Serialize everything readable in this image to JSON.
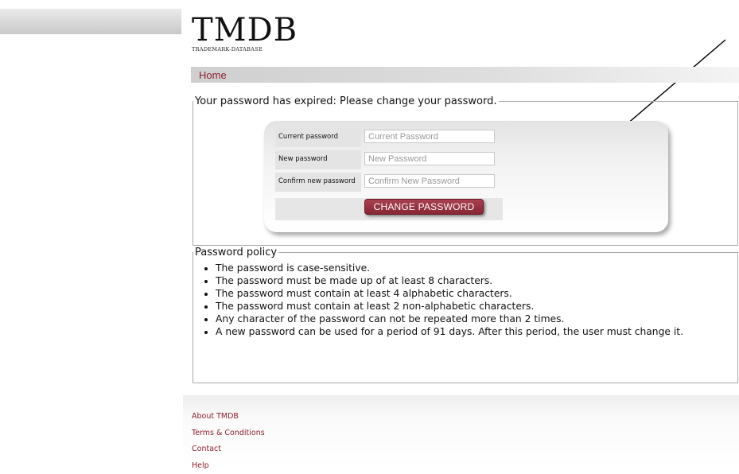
{
  "logo": {
    "title": "TMDB",
    "subtitle": "TRADEMARK-DATABASE"
  },
  "nav": {
    "home_label": "Home"
  },
  "change_password": {
    "legend": "Your password has expired: Please change your password.",
    "fields": [
      {
        "label": "Current password",
        "placeholder": "Current Password",
        "value": ""
      },
      {
        "label": "New password",
        "placeholder": "New Password",
        "value": ""
      },
      {
        "label": "Confirm new password",
        "placeholder": "Confirm New Password",
        "value": ""
      }
    ],
    "button_label": "CHANGE PASSWORD"
  },
  "policy": {
    "legend": "Password policy",
    "items": [
      "The password is case-sensitive.",
      "The password must be made up of at least 8 characters.",
      "The password must contain at least 4 alphabetic characters.",
      "The password must contain at least 2 non-alphabetic characters.",
      "Any character of the password can not be repeated more than 2 times.",
      "A new password can be used for a period of 91 days. After this period, the user must change it."
    ]
  },
  "footer": {
    "links": [
      "About TMDB",
      "Terms & Conditions",
      "Contact",
      "Help"
    ]
  },
  "colors": {
    "brand": "#8b1f2c",
    "button": "#962f3d"
  }
}
